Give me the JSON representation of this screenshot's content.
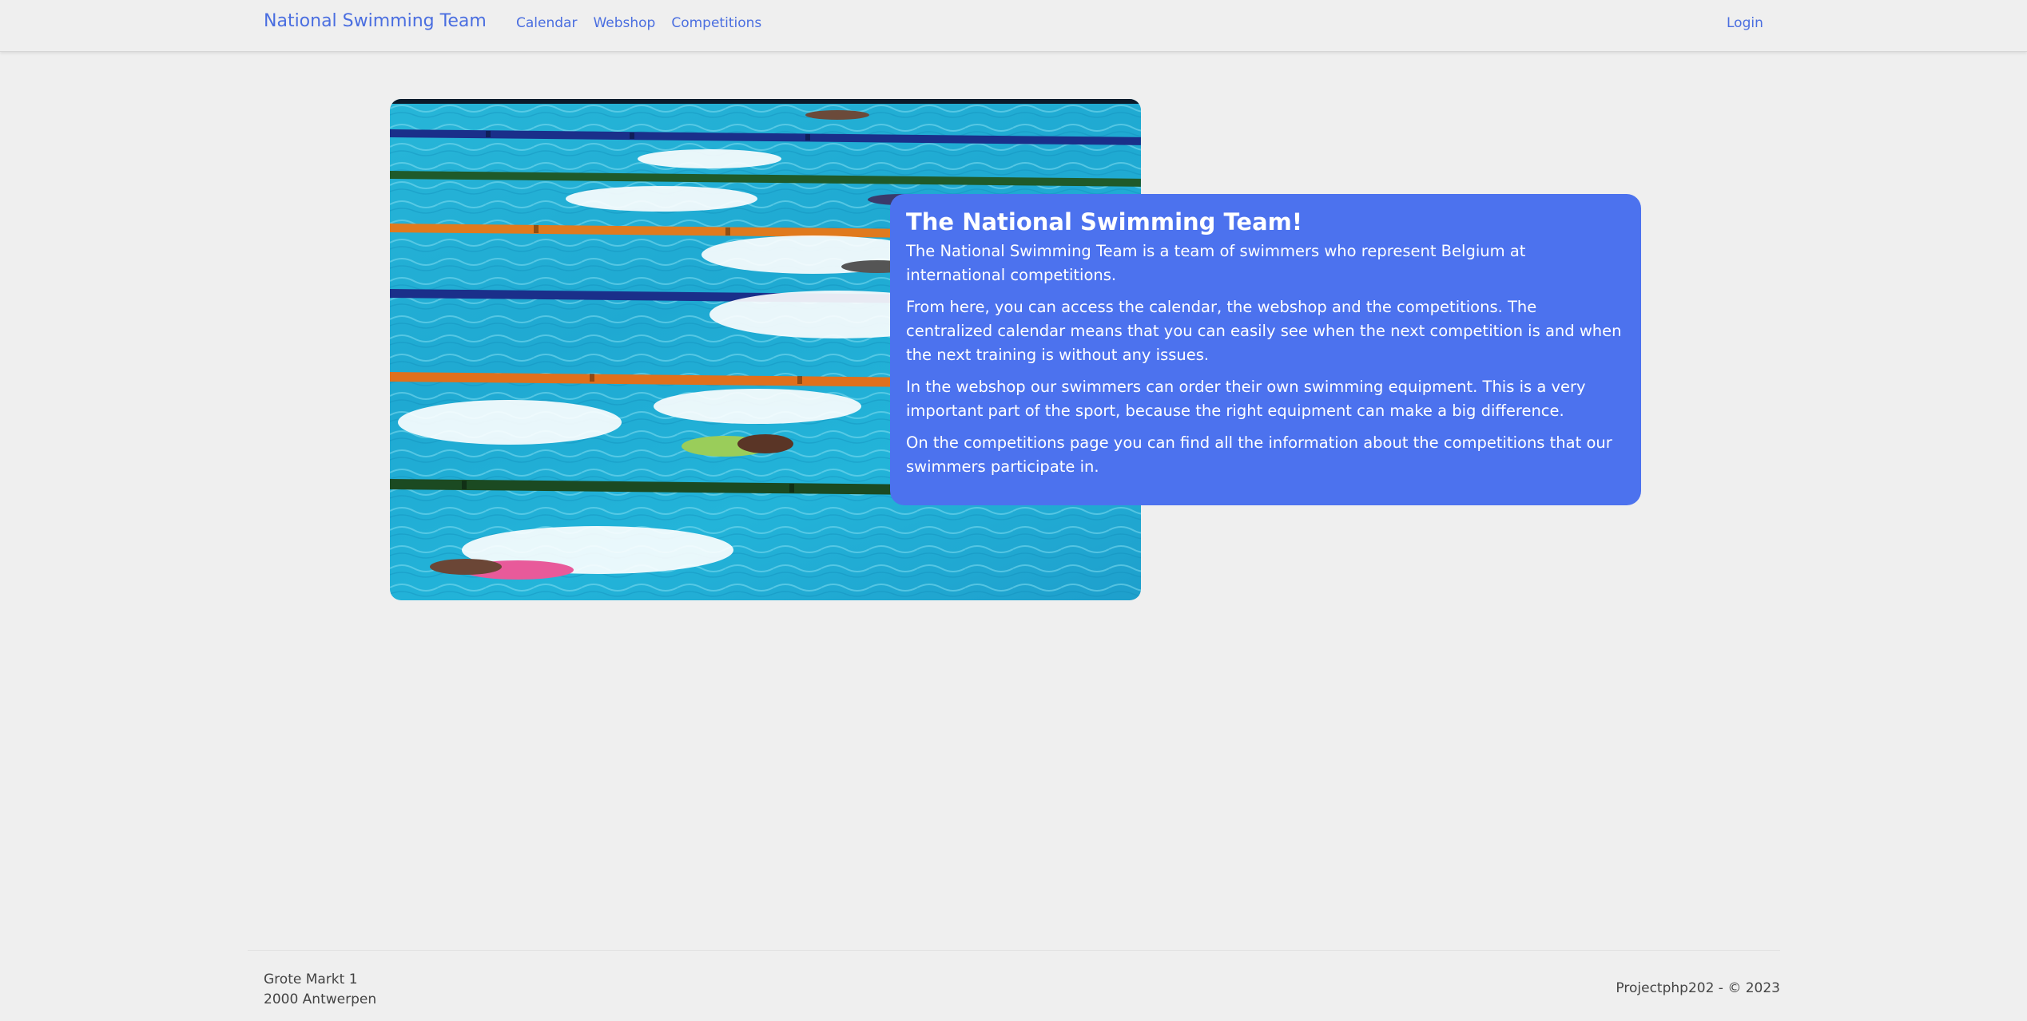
{
  "nav": {
    "brand": "National Swimming Team",
    "links": [
      "Calendar",
      "Webshop",
      "Competitions"
    ],
    "login": "Login"
  },
  "hero": {
    "image_alt": "Swimmers racing in a pool"
  },
  "info": {
    "title": "The National Swimming Team!",
    "paragraphs": [
      "The National Swimming Team is a team of swimmers who represent Belgium at international competitions.",
      "From here, you can access the calendar, the webshop and the competitions. The centralized calendar means that you can easily see when the next competition is and when the next training is without any issues.",
      "In the webshop our swimmers can order their own swimming equipment. This is a very important part of the sport, because the right equipment can make a big difference.",
      "On the competitions page you can find all the information about the competitions that our swimmers participate in."
    ]
  },
  "footer": {
    "address_line1": "Grote Markt 1",
    "address_line2": "2000 Antwerpen",
    "copyright": "Projectphp202 - © 2023"
  },
  "colors": {
    "accent": "#4a6ee0",
    "card": "#4c72ee",
    "background": "#efefef"
  }
}
